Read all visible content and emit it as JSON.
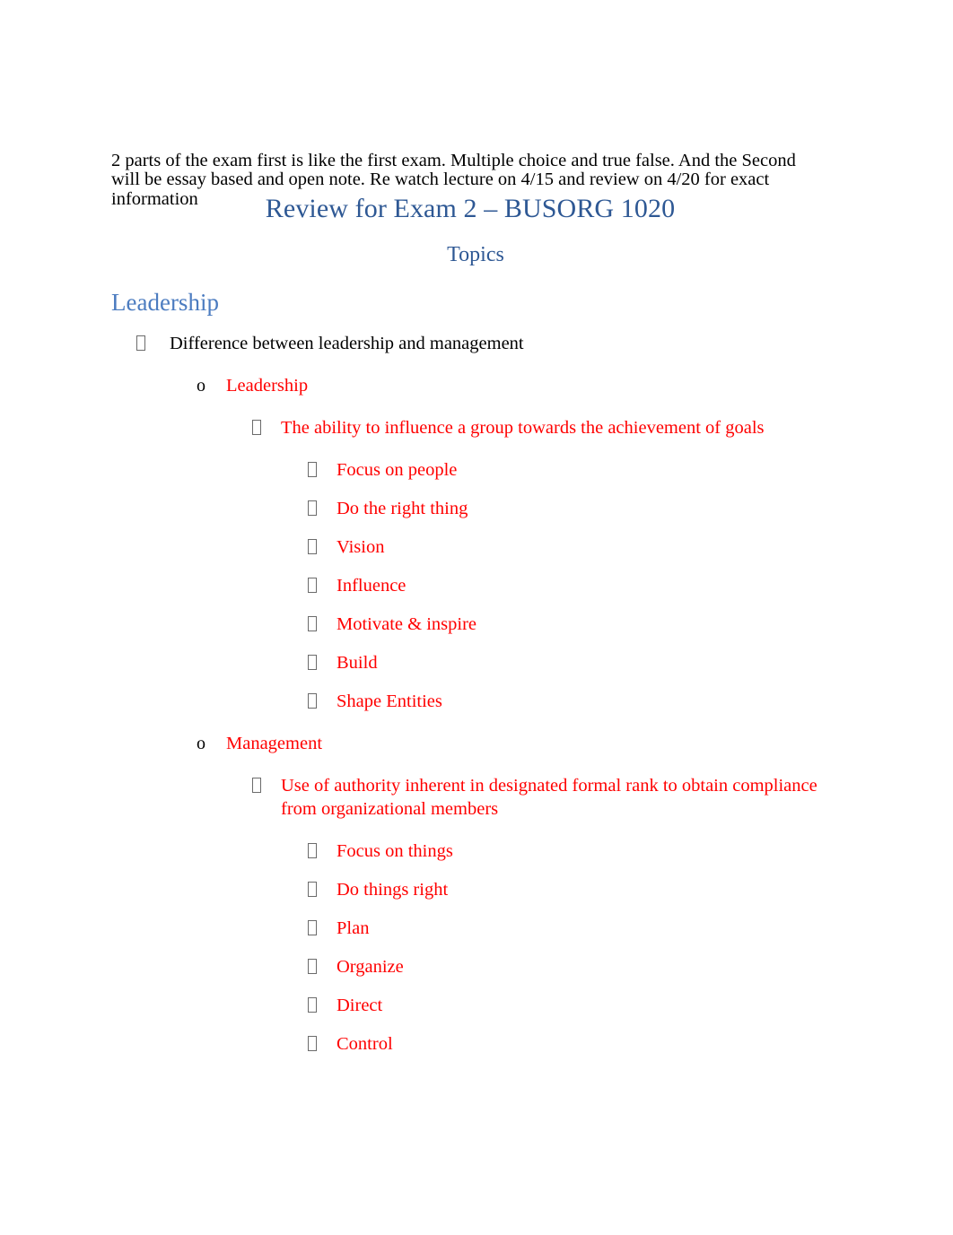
{
  "document": {
    "intro_paragraph": "2 parts of the exam first is like the first exam. Multiple choice and true false. And the Second will be essay based and open note. Re watch lecture on 4/15 and review on 4/20 for exact information",
    "title": "Review for Exam 2 – BUSORG 1020",
    "subtitle": "Topics",
    "colors": {
      "title_blue": "#2E5894",
      "heading_blue": "#4C7CC0",
      "body_black": "#000000",
      "accent_red": "#FF0000",
      "bullet_gray": "#6B6B6B",
      "page_background": "#FFFFFF"
    },
    "markers": {
      "level1": "missing-glyph-box",
      "level2": "o",
      "level3": "missing-glyph-box",
      "level4": "missing-glyph-box"
    }
  },
  "sections": [
    {
      "heading": "Leadership",
      "items": [
        {
          "level": 1,
          "text": "Difference between leadership and management"
        },
        {
          "level": 2,
          "text": "Leadership"
        },
        {
          "level": 3,
          "text": "The ability to influence a group towards the achievement of goals"
        },
        {
          "level": 4,
          "text": "Focus on people"
        },
        {
          "level": 4,
          "text": "Do the right thing"
        },
        {
          "level": 4,
          "text": "Vision"
        },
        {
          "level": 4,
          "text": "Influence"
        },
        {
          "level": 4,
          "text": "Motivate & inspire"
        },
        {
          "level": 4,
          "text": "Build"
        },
        {
          "level": 4,
          "text": "Shape Entities"
        },
        {
          "level": 2,
          "text": "Management"
        },
        {
          "level": 3,
          "text": "Use of authority inherent in designated formal rank to obtain compliance from organizational members"
        },
        {
          "level": 4,
          "text": "Focus on things"
        },
        {
          "level": 4,
          "text": "Do things right"
        },
        {
          "level": 4,
          "text": "Plan"
        },
        {
          "level": 4,
          "text": "Organize"
        },
        {
          "level": 4,
          "text": "Direct"
        },
        {
          "level": 4,
          "text": "Control"
        }
      ]
    }
  ]
}
